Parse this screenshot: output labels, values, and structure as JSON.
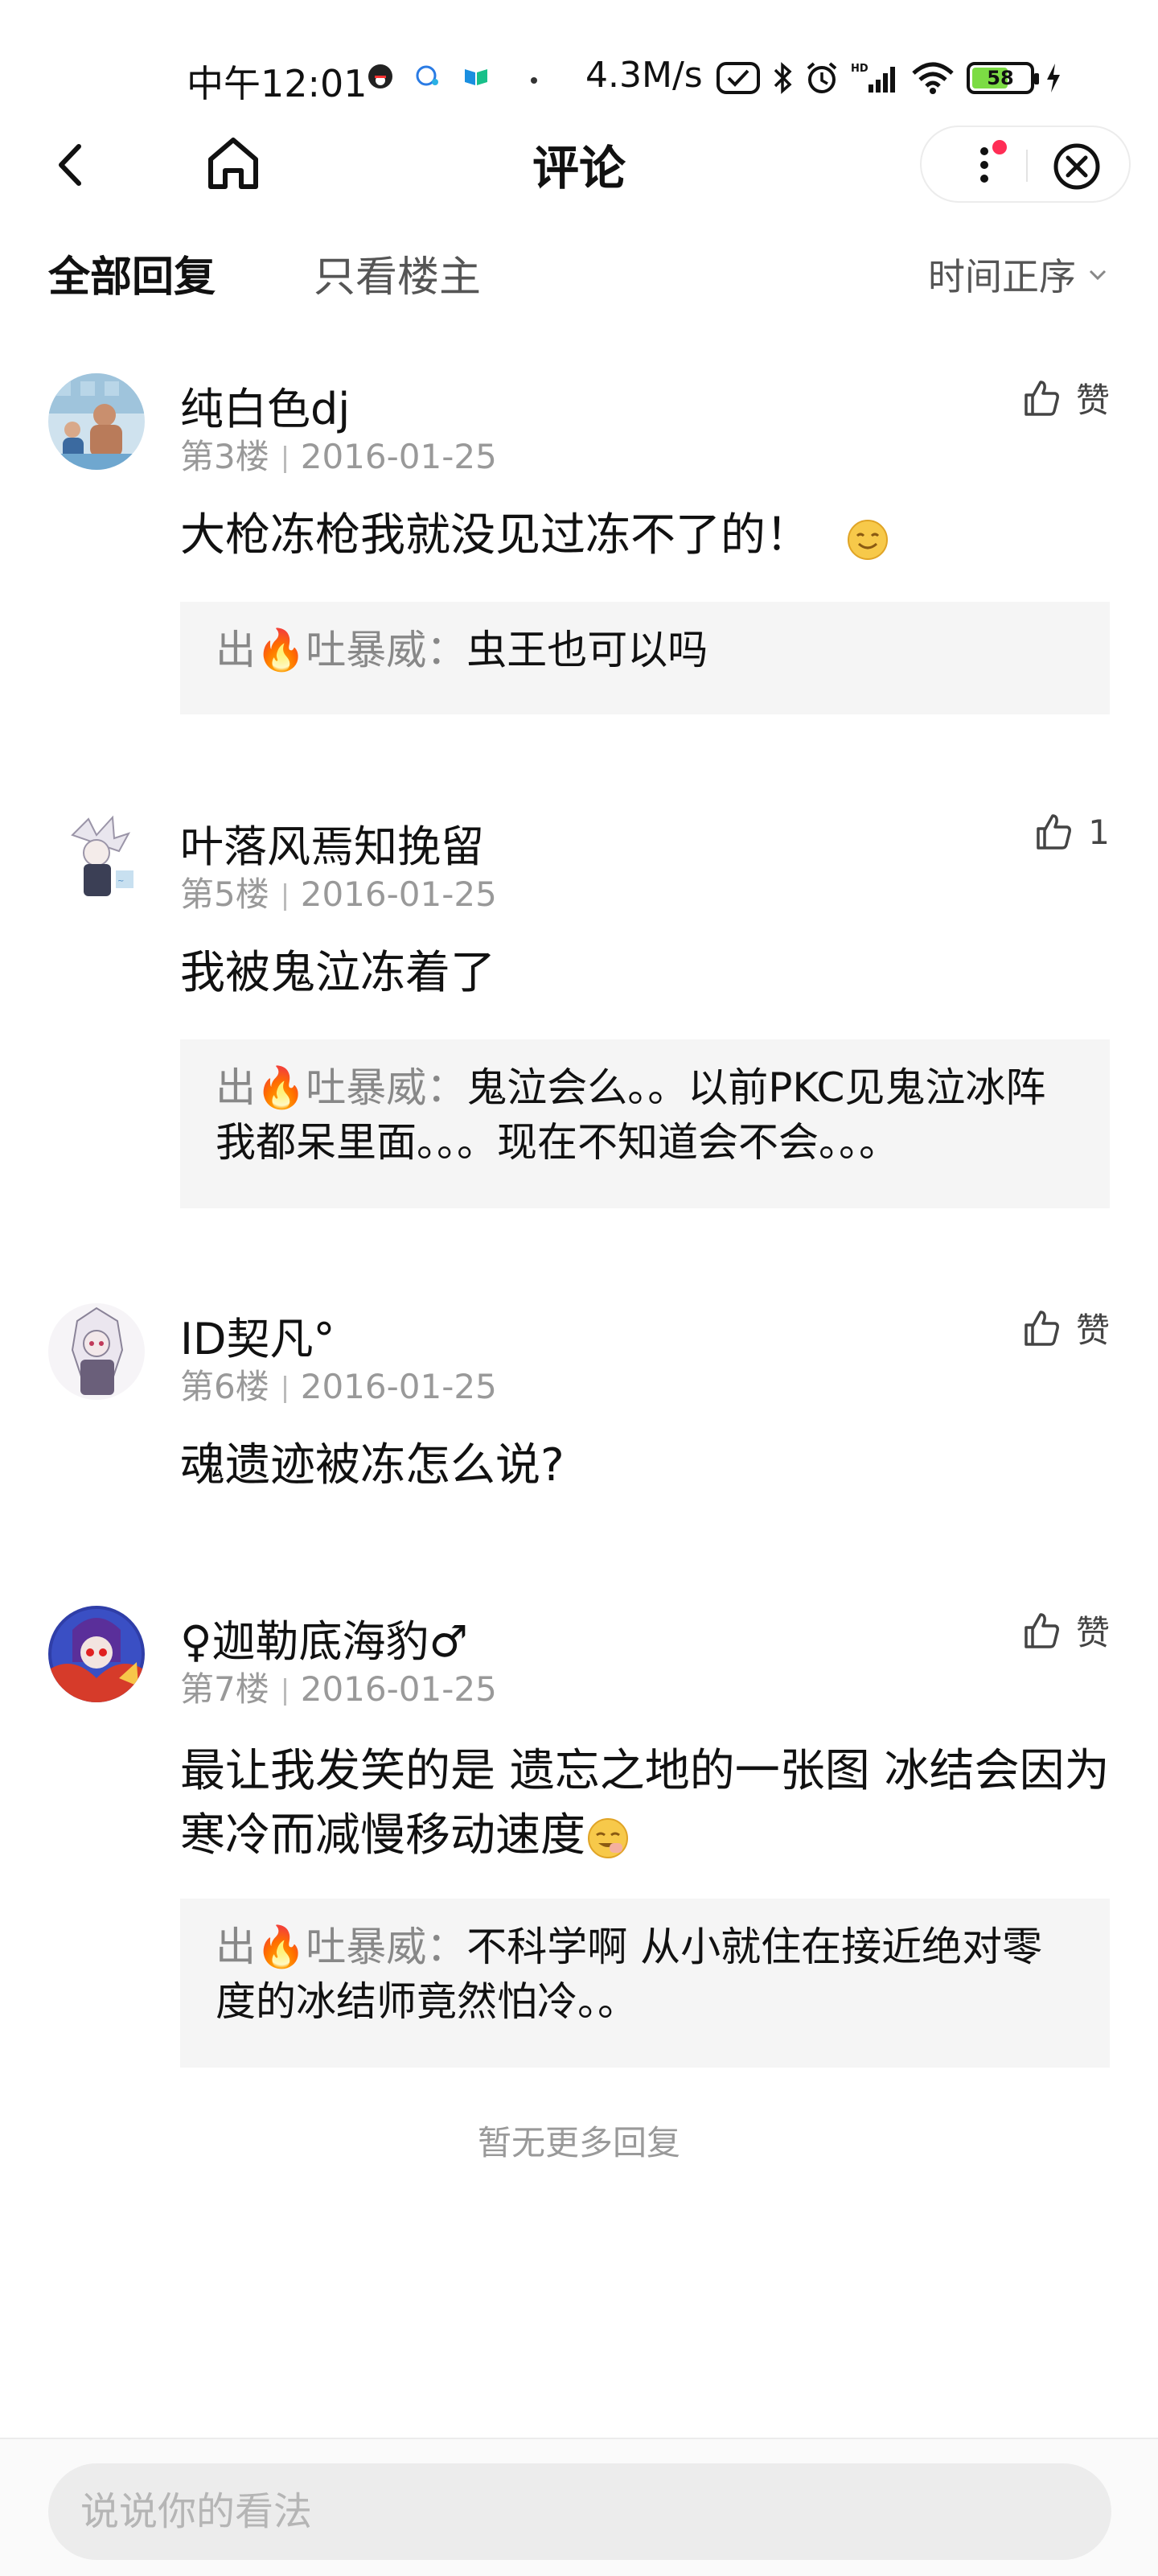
{
  "status_bar": {
    "time": "中午12:01",
    "net_speed": "4.3M/s",
    "battery": "58",
    "icons": [
      "qq-icon",
      "chat-notif-icon",
      "app-notif-icon",
      "dot",
      "nfc-icon",
      "bluetooth-icon",
      "alarm-icon",
      "hd-signal-icon",
      "wifi-icon",
      "battery-icon",
      "charging-icon"
    ]
  },
  "nav": {
    "title": "评论"
  },
  "tabs": {
    "all": "全部回复",
    "op_only": "只看楼主",
    "sort": "时间正序"
  },
  "comments": [
    {
      "username": "纯白色dj",
      "floor": "第3楼",
      "date": "2016-01-25",
      "like": "赞",
      "content": "大枪冻枪我就没见过冻不了的！",
      "emoji": "smile-emoji",
      "reply": {
        "name": "出🔥吐暴威：",
        "text": "虫王也可以吗"
      }
    },
    {
      "username": "叶落风焉知挽留",
      "floor": "第5楼",
      "date": "2016-01-25",
      "like": "1",
      "content": "我被鬼泣冻着了",
      "reply": {
        "name": "出🔥吐暴威：",
        "text": "鬼泣会么。。以前PKC见鬼泣冰阵我都呆里面。。。现在不知道会不会。。。"
      }
    },
    {
      "username": "ID契凡°",
      "floor": "第6楼",
      "date": "2016-01-25",
      "like": "赞",
      "content": "魂遗迹被冻怎么说?"
    },
    {
      "username": "♀迦勒底海豹♂",
      "floor": "第7楼",
      "date": "2016-01-25",
      "like": "赞",
      "content": "最让我发笑的是 遗忘之地的一张图 冰结会因为寒冷而减慢移动速度",
      "emoji": "laugh-emoji",
      "reply": {
        "name": "出🔥吐暴威：",
        "text": "不科学啊 从小就住在接近绝对零度的冰结师竟然怕冷。。"
      }
    }
  ],
  "footer": {
    "no_more": "暂无更多回复"
  },
  "input": {
    "placeholder": "说说你的看法"
  },
  "colors": {
    "text": "#111111",
    "meta": "#999999",
    "reply_bg": "#f5f5f5",
    "red_dot": "#ff2d55",
    "battery_fill": "#7cdc44"
  }
}
